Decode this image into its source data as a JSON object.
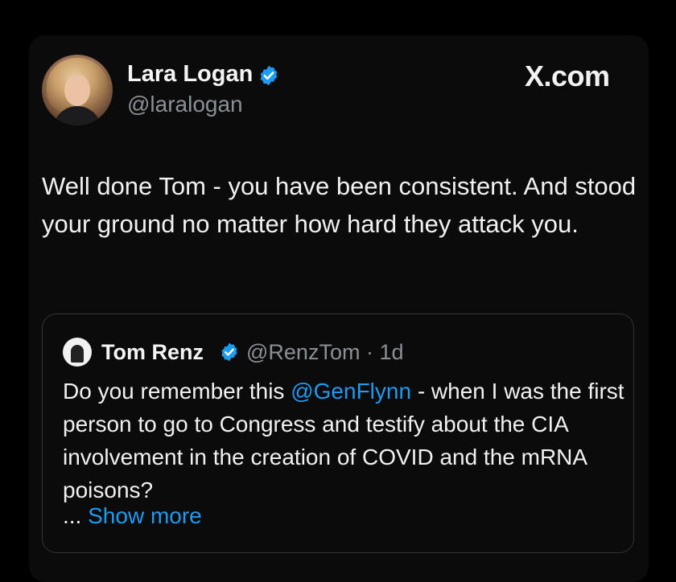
{
  "author": {
    "name": "Lara Logan",
    "handle": "@laralogan",
    "verified_icon": "verified-badge-icon"
  },
  "brand": {
    "label": "X.com"
  },
  "tweet": {
    "text": "Well done Tom - you have been consistent. And stood your ground no matter how hard they attack you."
  },
  "quoted": {
    "name": "Tom Renz",
    "handle": "@RenzTom",
    "separator": " · ",
    "time": "1d",
    "text_before": "Do you remember this ",
    "mention": "@GenFlynn",
    "text_after": " - when I was the first person to go to Congress and testify about the CIA involvement in the creation of COVID and the mRNA poisons?",
    "ellipsis": "... ",
    "show_more": "Show more"
  },
  "colors": {
    "background": "#000000",
    "link": "#1d9bf0",
    "verified": "#1d9bf0",
    "muted": "#8b9096"
  }
}
